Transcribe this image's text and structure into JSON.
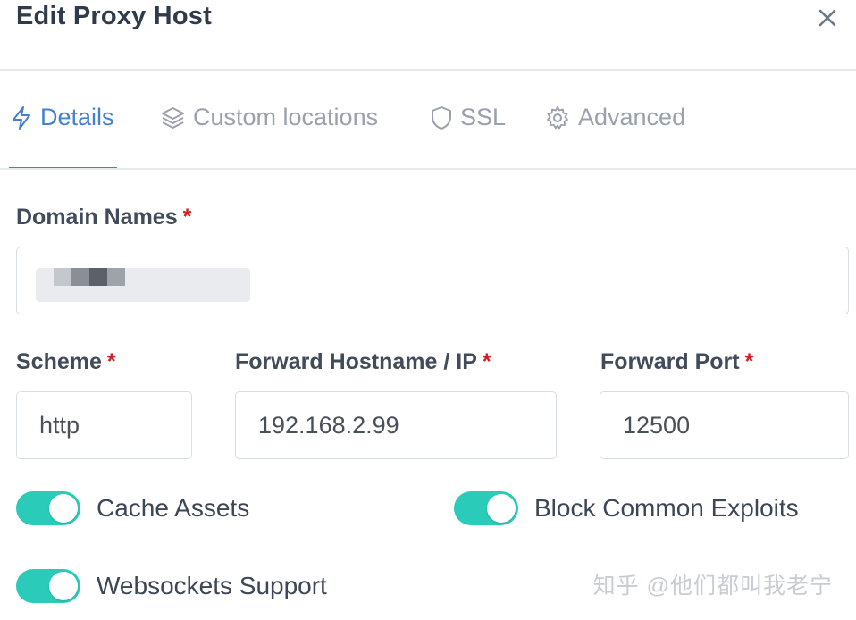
{
  "modal": {
    "title": "Edit Proxy Host",
    "close_icon": "close-icon"
  },
  "tabs": [
    {
      "label": "Details",
      "icon": "bolt-icon",
      "active": true
    },
    {
      "label": "Custom locations",
      "icon": "layers-icon",
      "active": false
    },
    {
      "label": "SSL",
      "icon": "shield-icon",
      "active": false
    },
    {
      "label": "Advanced",
      "icon": "gear-icon",
      "active": false
    }
  ],
  "form": {
    "domain_names": {
      "label": "Domain Names",
      "required_mark": "*",
      "value": ""
    },
    "scheme": {
      "label": "Scheme",
      "required_mark": "*",
      "value": "http"
    },
    "forward_host": {
      "label": "Forward Hostname / IP",
      "required_mark": "*",
      "value": "192.168.2.99"
    },
    "forward_port": {
      "label": "Forward Port",
      "required_mark": "*",
      "value": "12500"
    }
  },
  "toggles": [
    {
      "label": "Cache Assets",
      "enabled": true
    },
    {
      "label": "Block Common Exploits",
      "enabled": true
    },
    {
      "label": "Websockets Support",
      "enabled": true
    }
  ],
  "colors": {
    "accent": "#467fcf",
    "toggle_on": "#2bcbba",
    "required": "#cd201f"
  },
  "watermark": "知乎 @他们都叫我老宁"
}
